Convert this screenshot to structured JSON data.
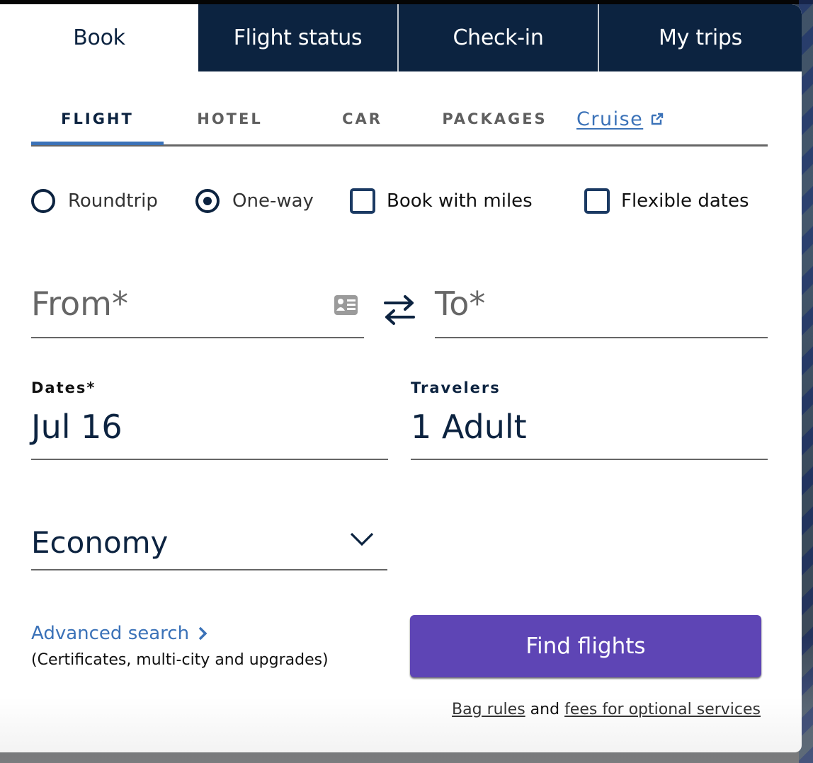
{
  "top_tabs": [
    {
      "label": "Book",
      "active": true
    },
    {
      "label": "Flight status",
      "active": false
    },
    {
      "label": "Check-in",
      "active": false
    },
    {
      "label": "My trips",
      "active": false
    }
  ],
  "sub_tabs": [
    {
      "label": "FLIGHT",
      "active": true
    },
    {
      "label": "HOTEL",
      "active": false
    },
    {
      "label": "CAR",
      "active": false
    },
    {
      "label": "PACKAGES",
      "active": false
    },
    {
      "label": "Cruise",
      "external": true
    }
  ],
  "trip_type": {
    "options": [
      {
        "label": "Roundtrip",
        "selected": false
      },
      {
        "label": "One-way",
        "selected": true
      }
    ]
  },
  "checkboxes": [
    {
      "label": "Book with miles",
      "checked": false
    },
    {
      "label": "Flexible dates",
      "checked": false
    }
  ],
  "from": {
    "placeholder": "From*",
    "value": ""
  },
  "to": {
    "placeholder": "To*",
    "value": ""
  },
  "dates": {
    "label": "Dates*",
    "value": "Jul 16"
  },
  "travelers": {
    "label": "Travelers",
    "value": "1 Adult"
  },
  "cabin": {
    "selected": "Economy"
  },
  "advanced_search": {
    "label": "Advanced search",
    "sublabel": "(Certificates, multi-city and upgrades)"
  },
  "find_button": {
    "label": "Find flights"
  },
  "footer": {
    "bag_rules": "Bag rules",
    "and": "and",
    "fees": "fees for optional services"
  },
  "colors": {
    "navy": "#0c2340",
    "link_blue": "#3b72b8",
    "button_purple": "#5e45b5"
  }
}
